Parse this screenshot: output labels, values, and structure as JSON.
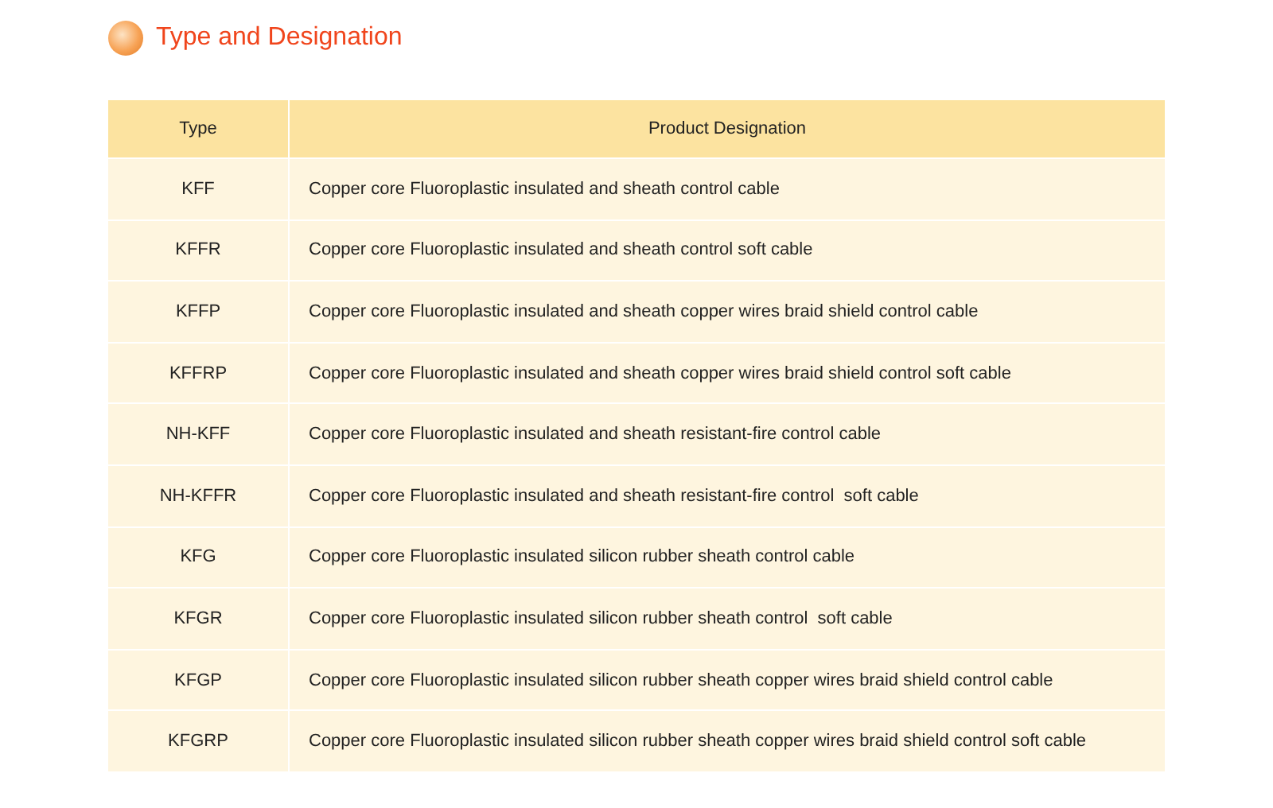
{
  "section": {
    "title": "Type and Designation"
  },
  "table": {
    "columns": [
      "Type",
      "Product Designation"
    ],
    "rows": [
      {
        "type": "KFF",
        "designation": "Copper core Fluoroplastic insulated and sheath control cable"
      },
      {
        "type": "KFFR",
        "designation": "Copper core Fluoroplastic insulated and sheath control soft cable"
      },
      {
        "type": "KFFP",
        "designation": "Copper core Fluoroplastic insulated and sheath copper wires braid shield control cable"
      },
      {
        "type": "KFFRP",
        "designation": "Copper core Fluoroplastic insulated and sheath copper wires braid shield control soft cable"
      },
      {
        "type": "NH-KFF",
        "designation": "Copper core Fluoroplastic insulated and sheath resistant-fire control cable"
      },
      {
        "type": "NH-KFFR",
        "designation": "Copper core Fluoroplastic insulated and sheath resistant-fire control  soft cable"
      },
      {
        "type": "KFG",
        "designation": "Copper core Fluoroplastic insulated silicon rubber sheath control cable"
      },
      {
        "type": "KFGR",
        "designation": "Copper core Fluoroplastic insulated silicon rubber sheath control  soft cable"
      },
      {
        "type": "KFGP",
        "designation": "Copper core Fluoroplastic insulated silicon rubber sheath copper wires braid shield control cable"
      },
      {
        "type": "KFGRP",
        "designation": "Copper core Fluoroplastic insulated silicon rubber sheath copper wires braid shield control soft cable"
      }
    ]
  }
}
